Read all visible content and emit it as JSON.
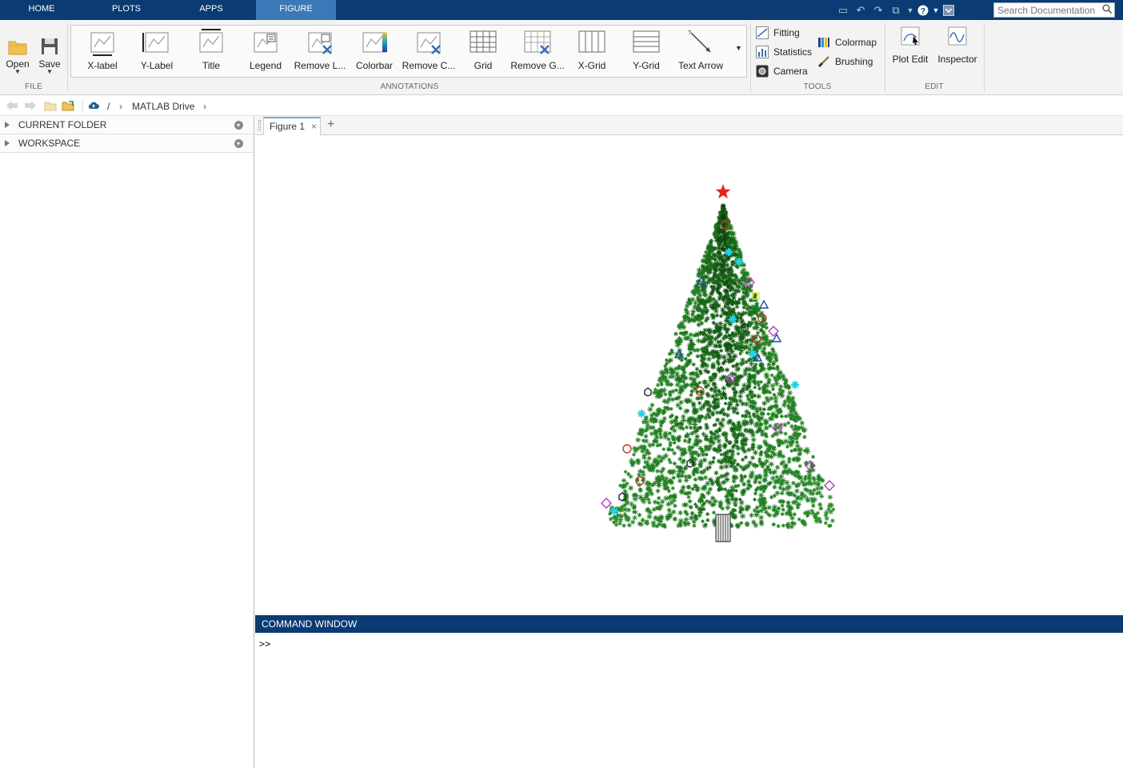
{
  "tabs": [
    {
      "label": "HOME"
    },
    {
      "label": "PLOTS"
    },
    {
      "label": "APPS"
    },
    {
      "label": "FIGURE",
      "active": true
    }
  ],
  "search": {
    "placeholder": "Search Documentation"
  },
  "ribbon": {
    "file": {
      "label": "FILE",
      "open": "Open",
      "save": "Save"
    },
    "annotations": {
      "label": "ANNOTATIONS",
      "buttons": [
        "X-label",
        "Y-Label",
        "Title",
        "Legend",
        "Remove L...",
        "Colorbar",
        "Remove C...",
        "Grid",
        "Remove G...",
        "X-Grid",
        "Y-Grid",
        "Text Arrow"
      ]
    },
    "tools": {
      "label": "TOOLS",
      "items": [
        "Fitting",
        "Statistics",
        "Camera",
        "Colormap",
        "Brushing"
      ]
    },
    "edit": {
      "label": "EDIT",
      "plot_edit": "Plot Edit",
      "inspector": "Inspector"
    }
  },
  "address": {
    "root": "/",
    "folder": "MATLAB Drive"
  },
  "left_panel": {
    "current_folder": "CURRENT FOLDER",
    "workspace": "WORKSPACE"
  },
  "figure": {
    "tab": "Figure 1",
    "add": "+"
  },
  "command_window": {
    "title": "COMMAND WINDOW",
    "prompt": ">>"
  },
  "colors": {
    "accent": "#0b3b73",
    "tree": "#1b6e1b",
    "star": "#e8231b"
  }
}
